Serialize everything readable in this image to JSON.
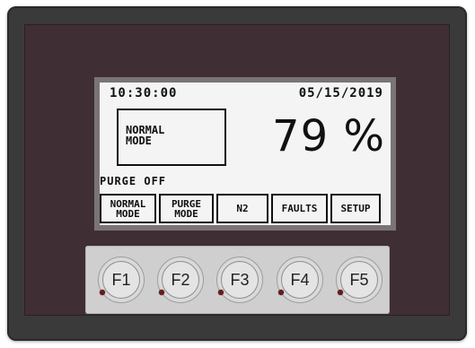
{
  "display": {
    "time": "10:30:00",
    "date": "05/15/2019",
    "mode_box": "NORMAL\nMODE",
    "percent": "79 %",
    "status": "PURGE OFF"
  },
  "softkeys": [
    {
      "label": "NORMAL\nMODE"
    },
    {
      "label": "PURGE\nMODE"
    },
    {
      "label": "N2"
    },
    {
      "label": "FAULTS"
    },
    {
      "label": "SETUP"
    }
  ],
  "function_keys": [
    {
      "label": "F1"
    },
    {
      "label": "F2"
    },
    {
      "label": "F3"
    },
    {
      "label": "F4"
    },
    {
      "label": "F5"
    }
  ],
  "colors": {
    "housing": "#3a3a3a",
    "bezel": "#3f2f35",
    "lcd_background": "#f4f4f4",
    "keypad": "#cfcfcf",
    "led": "#6b1a14"
  }
}
